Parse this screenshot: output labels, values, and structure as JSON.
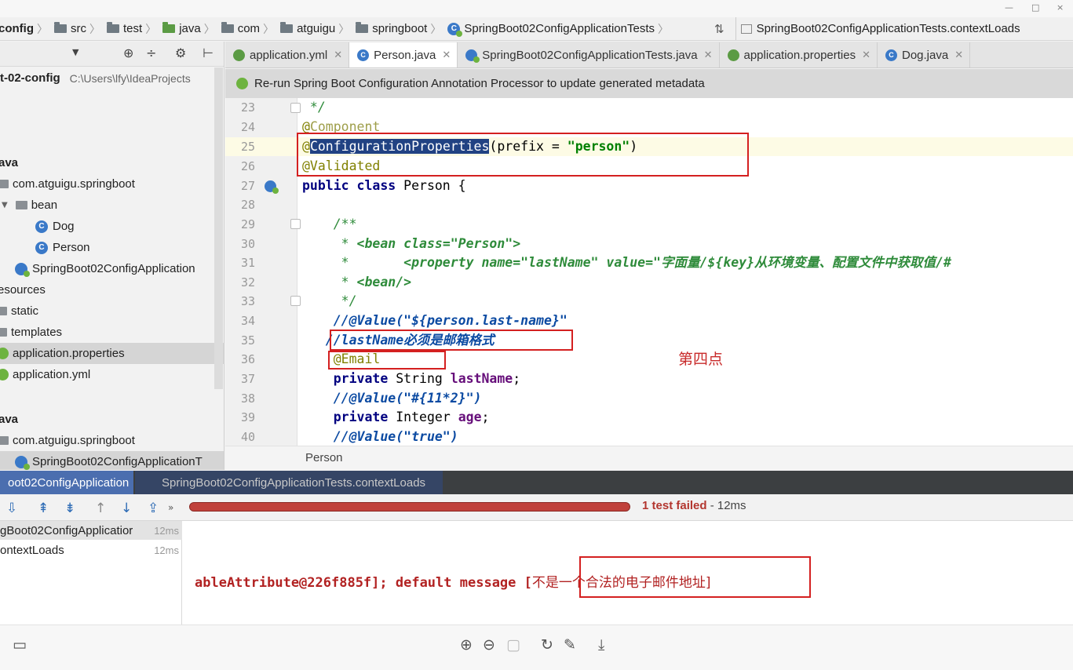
{
  "window": {
    "controls": [
      "—",
      "□",
      "×"
    ]
  },
  "breadcrumb": {
    "items": [
      "config",
      "src",
      "test",
      "java",
      "com",
      "atguigu",
      "springboot",
      "SpringBoot02ConfigApplicationTests"
    ],
    "run_config": "SpringBoot02ConfigApplicationTests.contextLoads"
  },
  "project": {
    "root_name": "t-02-config",
    "root_path": "C:\\Users\\lfy\\IdeaProjects",
    "tree": [
      {
        "label": "ava"
      },
      {
        "label": "com.atguigu.springboot"
      },
      {
        "label": "bean"
      },
      {
        "label": "Dog"
      },
      {
        "label": "Person"
      },
      {
        "label": "SpringBoot02ConfigApplication"
      },
      {
        "label": "esources"
      },
      {
        "label": "static"
      },
      {
        "label": "templates"
      },
      {
        "label": "application.properties"
      },
      {
        "label": "application.yml"
      },
      {
        "label": "ava"
      },
      {
        "label": "com.atguigu.springboot"
      },
      {
        "label": "SpringBoot02ConfigApplicationT"
      }
    ]
  },
  "tabs": [
    {
      "label": "application.yml",
      "active": false
    },
    {
      "label": "Person.java",
      "active": true
    },
    {
      "label": "SpringBoot02ConfigApplicationTests.java",
      "active": false
    },
    {
      "label": "application.properties",
      "active": false
    },
    {
      "label": "Dog.java",
      "active": false
    }
  ],
  "notice": {
    "text": "Re-run Spring Boot Configuration Annotation Processor to update generated metadata"
  },
  "editor": {
    "line_numbers": [
      "23",
      "24",
      "25",
      "26",
      "27",
      "28",
      "29",
      "30",
      "31",
      "32",
      "33",
      "34",
      "35",
      "36",
      "37",
      "38",
      "39",
      "40"
    ],
    "lines": {
      "l23": " */",
      "l24a": "@",
      "l24b": "Component",
      "l25a": "@",
      "l25b": "ConfigurationProperties",
      "l25c": "(prefix = ",
      "l25d": "\"person\"",
      "l25e": ")",
      "l26": "@Validated",
      "l27a": "public class ",
      "l27b": "Person {",
      "l29": "    /**",
      "l30a": "     * ",
      "l30b": "<bean class=\"Person\">",
      "l31a": "     *       ",
      "l31b": "<property name=\"lastName\" value=\"",
      "l31c": "字面量/${key}从环境变量、配置文件中获取值/#",
      "l32a": "     * ",
      "l32b": "<bean/>",
      "l33": "     */",
      "l34": "    //@Value(\"${person.last-name}\"",
      "l35": "   //lastName必须是邮箱格式",
      "l36": "    @Email",
      "l37a": "    private ",
      "l37b": "String ",
      "l37c": "lastName",
      "l37d": ";",
      "l38": "    //@Value(\"#{11*2}\")",
      "l39a": "    private ",
      "l39b": "Integer ",
      "l39c": "age",
      "l39d": ";",
      "l40": "    //@Value(\"true\")"
    },
    "annotation_note": "第四点",
    "footer_crumb": "Person"
  },
  "run": {
    "tabs": [
      {
        "label": "oot02ConfigApplication",
        "active": true
      },
      {
        "label": "SpringBoot02ConfigApplicationTests.contextLoads",
        "active": false
      }
    ],
    "status_count": "1 test failed",
    "status_time": " - 12ms",
    "progress_fraction": 1.0,
    "tree": [
      {
        "label": "gBoot02ConfigApplicatior",
        "time": "12ms"
      },
      {
        "label": "ontextLoads",
        "time": "12ms"
      }
    ],
    "console_prefix": "ableAttribute@226f885f]; default message [",
    "console_msg": "不是一个合法的电子邮件地址]"
  },
  "colors": {
    "highlight_box": "#d42020",
    "progress_failed": "#c0413b",
    "run_tab_active": "#4b6eaf"
  }
}
